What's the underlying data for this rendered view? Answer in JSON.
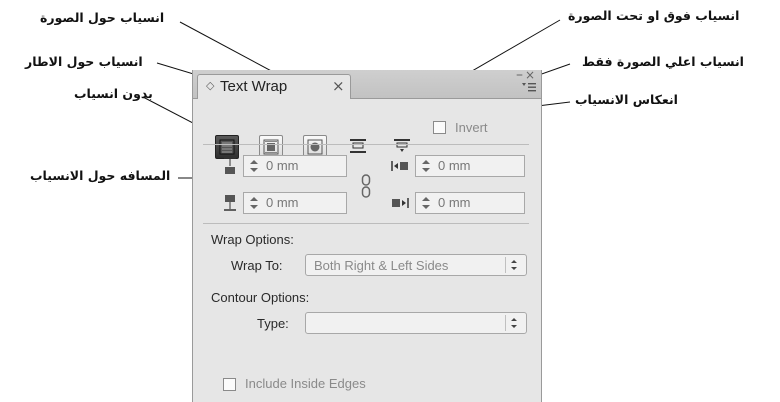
{
  "callouts": {
    "wrap_around_image": "انسياب حول الصورة",
    "wrap_around_frame": "انسياب حول الاطار",
    "no_wrap": "بدون انسياب",
    "wrap_above_below": "انسياب فوق او تحت الصورة",
    "wrap_top_only": "انسياب اعلي الصورة فقط",
    "invert_wrap": "انعكاس الانسياب",
    "wrap_offset": "المسافه حول الانسياب"
  },
  "panel": {
    "tab_title": "Text Wrap",
    "tab_close": "×",
    "window_min": "–",
    "window_close": "×",
    "invert_label": "Invert",
    "offsets": {
      "top": "0 mm",
      "bottom": "0 mm",
      "left": "0 mm",
      "right": "0 mm"
    },
    "wrap_options_label": "Wrap Options:",
    "wrap_to_label": "Wrap To:",
    "wrap_to_value": "Both Right & Left Sides",
    "contour_options_label": "Contour Options:",
    "type_label": "Type:",
    "type_value": "",
    "include_inside_edges_label": "Include Inside Edges"
  },
  "icons": {
    "tab_diamond": "diamond-icon",
    "panel_menu": "panel-menu-icon",
    "link": "chain-link-icon"
  }
}
